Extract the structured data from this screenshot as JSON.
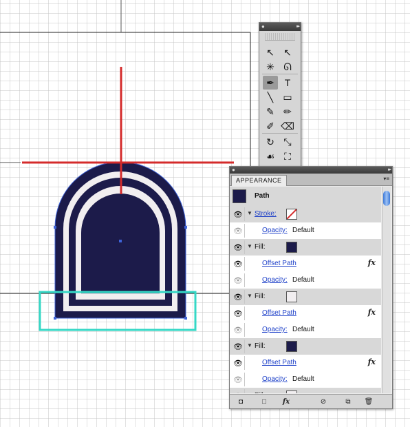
{
  "tools_panel": {
    "tools": [
      {
        "name": "selection-tool-icon",
        "glyph": "↖"
      },
      {
        "name": "direct-selection-tool-icon",
        "glyph": "↖"
      },
      {
        "name": "magic-wand-tool-icon",
        "glyph": "✳"
      },
      {
        "name": "lasso-tool-icon",
        "glyph": "ᘏ"
      },
      {
        "name": "pen-tool-icon",
        "glyph": "✒"
      },
      {
        "name": "type-tool-icon",
        "glyph": "T"
      },
      {
        "name": "line-tool-icon",
        "glyph": "╲"
      },
      {
        "name": "rectangle-tool-icon",
        "glyph": "▭"
      },
      {
        "name": "paintbrush-tool-icon",
        "glyph": "✎"
      },
      {
        "name": "pencil-tool-icon",
        "glyph": "✏"
      },
      {
        "name": "blob-brush-tool-icon",
        "glyph": "✐"
      },
      {
        "name": "eraser-tool-icon",
        "glyph": "⌫"
      },
      {
        "name": "rotate-tool-icon",
        "glyph": "↻"
      },
      {
        "name": "scale-tool-icon",
        "glyph": "⤡"
      },
      {
        "name": "warp-tool-icon",
        "glyph": "☙"
      },
      {
        "name": "free-transform-tool-icon",
        "glyph": "⛶"
      }
    ]
  },
  "appearance_panel": {
    "tab_label": "APPEARANCE",
    "path_label": "Path",
    "stroke_label": "Stroke:",
    "opacity_label": "Opacity:",
    "opacity_value": "Default",
    "fill_label": "Fill:",
    "offset_path_label": "Offset Path",
    "fx_glyph": "fx"
  },
  "colors": {
    "navy": "#1c1b4a",
    "cream": "#f1eef0",
    "guide_red": "#d42b2b",
    "selection_blue": "#3e63d8",
    "teal": "#35d8c6"
  }
}
